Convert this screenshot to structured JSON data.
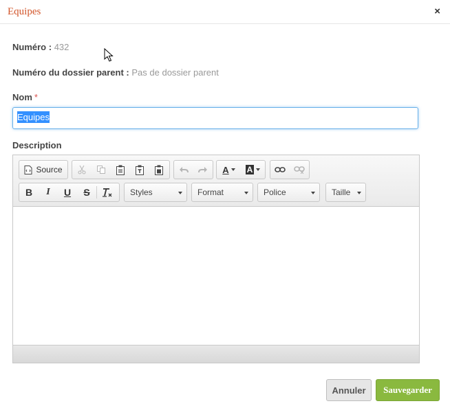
{
  "dialog": {
    "title": "Equipes",
    "close_label": "×"
  },
  "fields": {
    "numero": {
      "label": "Numéro :",
      "value": "432"
    },
    "parent": {
      "label": "Numéro du dossier parent :",
      "value": "Pas de dossier parent"
    },
    "nom": {
      "label": "Nom",
      "required_mark": "*",
      "value": "Equipes"
    },
    "description": {
      "label": "Description"
    }
  },
  "toolbar": {
    "source_label": "Source",
    "bold_label": "B",
    "italic_label": "I",
    "underline_label": "U",
    "strike_label": "S",
    "styles_label": "Styles",
    "format_label": "Format",
    "font_label": "Police",
    "size_label": "Taille",
    "text_color_label": "A",
    "bg_color_label": "A"
  },
  "buttons": {
    "cancel": "Annuler",
    "save": "Sauvegarder"
  },
  "colors": {
    "title": "#d2552a",
    "save": "#8ab93f",
    "required": "#d9534f",
    "focus": "#66afe9"
  }
}
